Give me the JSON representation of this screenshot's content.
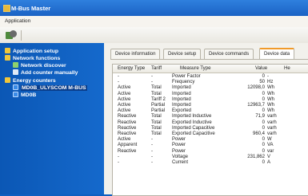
{
  "window": {
    "title": "M-Bus Master"
  },
  "menu": {
    "application": "Application"
  },
  "tree": {
    "items": [
      {
        "label": "Application setup",
        "icon": "gear-icon"
      },
      {
        "label": "Network functions",
        "icon": "network-icon"
      },
      {
        "label": "Network discover",
        "icon": "search-icon"
      },
      {
        "label": "Add counter manually",
        "icon": "add-icon"
      },
      {
        "label": "Energy counters",
        "icon": "counter-icon"
      },
      {
        "label": "MD0B_ULYSCOM M-BUS",
        "icon": "device-icon"
      },
      {
        "label": "MD0B",
        "icon": "device-icon"
      }
    ]
  },
  "tabs": [
    "Device information",
    "Device setup",
    "Device commands",
    "Device data"
  ],
  "active_tab": "Device data",
  "table": {
    "headers": [
      "Energy Type",
      "Tariff",
      "Measure Type",
      "Value",
      "He"
    ],
    "rows": [
      [
        "-",
        "-",
        "Power Factor",
        "0",
        "-"
      ],
      [
        "-",
        "-",
        "Frequency",
        "50",
        "Hz"
      ],
      [
        "Active",
        "Total",
        "Imported",
        "12098,0",
        "Wh"
      ],
      [
        "Active",
        "Total",
        "Imported",
        "0",
        "Wh"
      ],
      [
        "Active",
        "Tariff 2",
        "Imported",
        "0",
        "Wh"
      ],
      [
        "Active",
        "Partial",
        "Imported",
        "12963,7",
        "Wh"
      ],
      [
        "Active",
        "Partial",
        "Exported",
        "0",
        "Wh"
      ],
      [
        "Reactive",
        "Total",
        "Imported Inductive",
        "71,9",
        "varh"
      ],
      [
        "Reactive",
        "Total",
        "Exported Inductive",
        "0",
        "varh"
      ],
      [
        "Reactive",
        "Total",
        "Imported Capacitive",
        "0",
        "varh"
      ],
      [
        "Reactive",
        "Total",
        "Exported Capacitive",
        "960,4",
        "varh"
      ],
      [
        "Active",
        "-",
        "Power",
        "0",
        "W"
      ],
      [
        "Apparent",
        "-",
        "Power",
        "0",
        "VA"
      ],
      [
        "Reactive",
        "-",
        "Power",
        "0",
        "var"
      ],
      [
        "-",
        "-",
        "Voltage",
        "231,862",
        "V"
      ],
      [
        "-",
        "-",
        "Current",
        "0",
        "A"
      ]
    ]
  }
}
